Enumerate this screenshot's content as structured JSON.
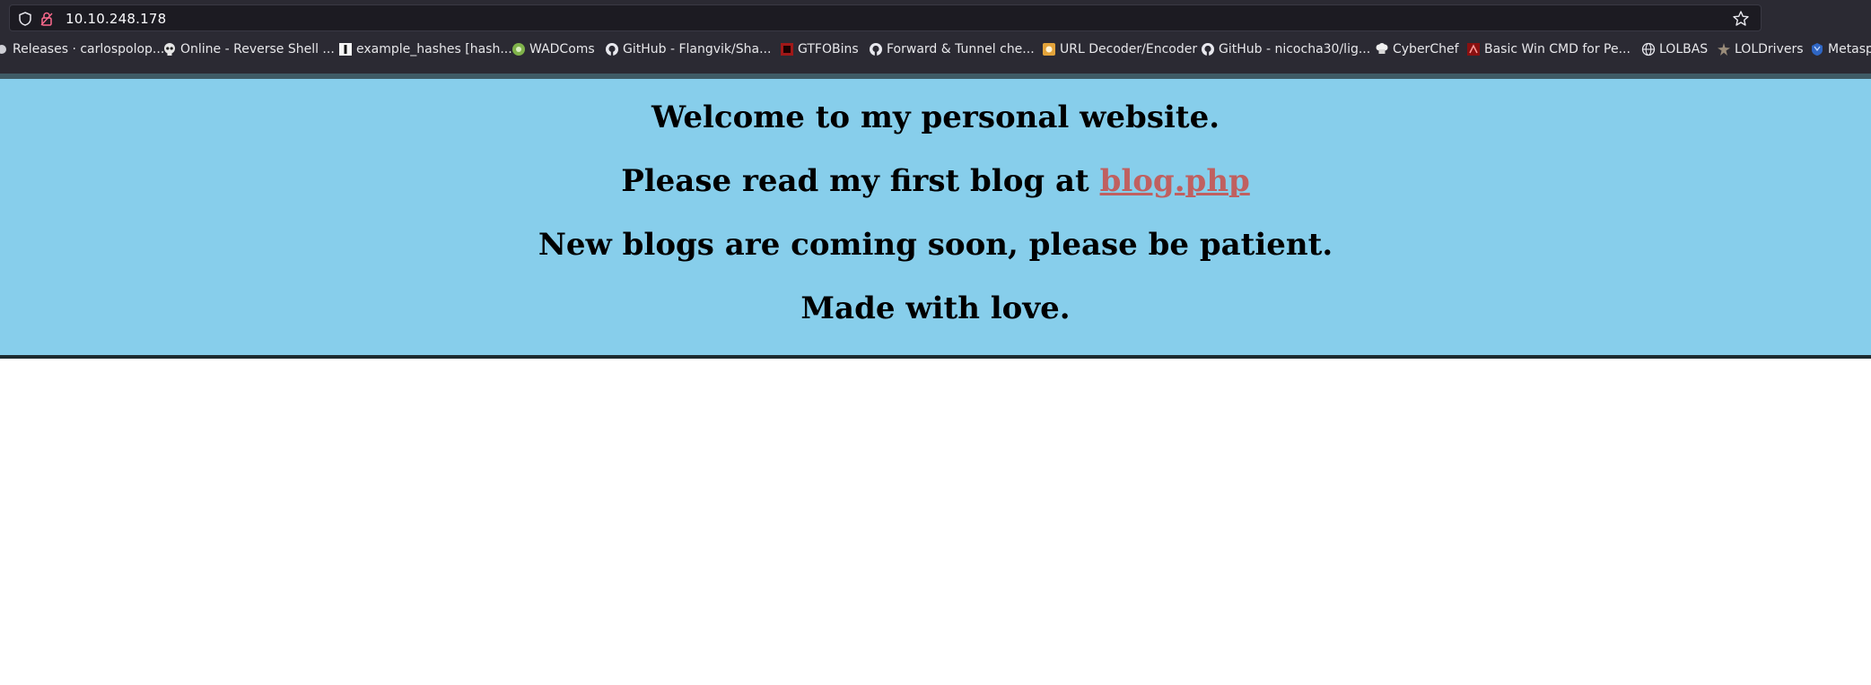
{
  "browser": {
    "url": "10.10.248.178",
    "bookmarks": [
      {
        "label": "Releases · carlospolop...",
        "icon": "dot-icon"
      },
      {
        "label": "Online - Reverse Shell ...",
        "icon": "skull-icon"
      },
      {
        "label": "example_hashes [hash...",
        "icon": "hashcat-icon"
      },
      {
        "label": "WADComs",
        "icon": "wadcoms-icon"
      },
      {
        "label": "GitHub - Flangvik/Sha...",
        "icon": "github-icon"
      },
      {
        "label": "GTFOBins",
        "icon": "gtfobins-icon"
      },
      {
        "label": "Forward & Tunnel che...",
        "icon": "github-icon"
      },
      {
        "label": "URL Decoder/Encoder",
        "icon": "url-decoder-icon"
      },
      {
        "label": "GitHub - nicocha30/lig...",
        "icon": "github-icon"
      },
      {
        "label": "CyberChef",
        "icon": "chef-hat-icon"
      },
      {
        "label": "Basic Win CMD for Pe...",
        "icon": "red-square-icon"
      },
      {
        "label": "LOLBAS",
        "icon": "globe-icon"
      },
      {
        "label": "LOLDrivers",
        "icon": "loldrivers-icon"
      },
      {
        "label": "Metasp",
        "icon": "metasploit-icon"
      }
    ]
  },
  "page": {
    "line1": "Welcome to my personal website.",
    "line2_prefix": "Please read my first blog at ",
    "line2_link": "blog.php",
    "line3": "New blogs are coming soon, please be patient.",
    "line4": "Made with love."
  },
  "colors": {
    "hero_background": "#87ceeb",
    "link": "#c06060",
    "chrome_background": "#2b2a33"
  }
}
